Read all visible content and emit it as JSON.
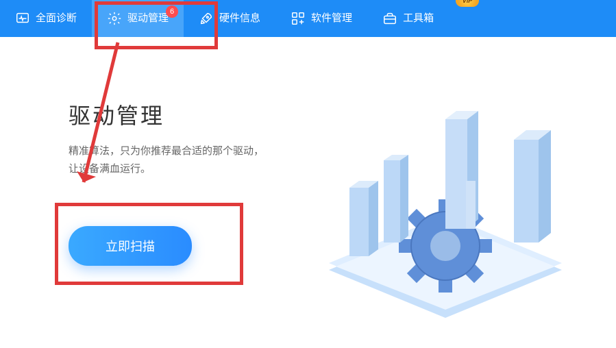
{
  "nav": {
    "items": [
      {
        "label": "全面诊断",
        "icon": "monitor-heart",
        "active": false,
        "badge": null
      },
      {
        "label": "驱动管理",
        "icon": "gear",
        "active": true,
        "badge": "6"
      },
      {
        "label": "硬件信息",
        "icon": "rocket",
        "active": false,
        "badge": null
      },
      {
        "label": "软件管理",
        "icon": "grid-plus",
        "active": false,
        "badge": null
      },
      {
        "label": "工具箱",
        "icon": "toolbox",
        "active": false,
        "badge": null
      }
    ],
    "vip_label": "VIP"
  },
  "main": {
    "title": "驱动管理",
    "desc_line1": "精准算法，只为你推荐最合适的那个驱动，",
    "desc_line2": "让设备满血运行。",
    "scan_button": "立即扫描"
  },
  "colors": {
    "primary": "#1e8cf7",
    "accent": "#2a8cff",
    "danger": "#ff4d4f",
    "annotation": "#e03a3a"
  }
}
